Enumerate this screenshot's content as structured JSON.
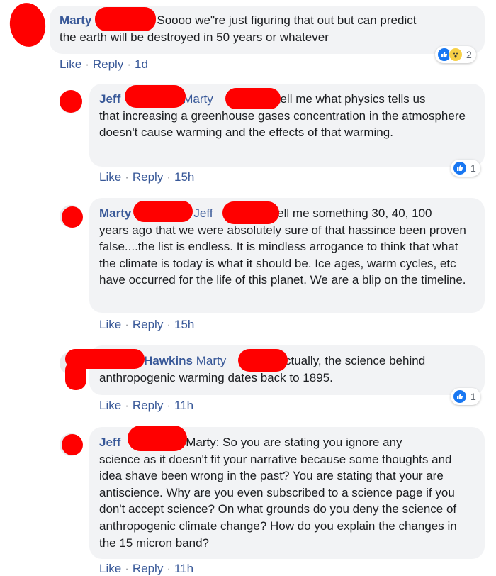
{
  "reaction_colors": {
    "like": "#1877f2",
    "wow": "#f7d046"
  },
  "comments": [
    {
      "author": "Marty",
      "text_line1": "Soooo we\"re just figuring that out but can predict",
      "text_rest": "the earth will be destroyed in 50 years or whatever",
      "like": "Like",
      "reply": "Reply",
      "time": "1d",
      "reactions": [
        "like-reaction-icon",
        "wow-reaction-icon"
      ],
      "reaction_count": "2"
    },
    {
      "author": "Jeff",
      "mention": "Marty",
      "text_line1": "tell me what physics tells us",
      "text_rest": "that increasing a greenhouse gases concentration in the atmosphere doesn't cause warming and the effects of that warming.",
      "like": "Like",
      "reply": "Reply",
      "time": "15h",
      "reactions": [
        "like-reaction-icon"
      ],
      "reaction_count": "1"
    },
    {
      "author": "Marty",
      "mention": "Jeff",
      "text_line1": "tell me something 30, 40, 100",
      "text_rest": "years ago that we were absolutely sure of that hassince been proven false....the list is endless. It is mindless arrogance to think that what the climate is today is what it should be. Ice ages, warm cycles, etc have occurred for the life of this planet. We are a blip on the timeline.",
      "like": "Like",
      "reply": "Reply",
      "time": "15h"
    },
    {
      "author": "Hawkins",
      "mention": "Marty",
      "text_line1": "r Actually, the science behind",
      "text_rest": "anthropogenic warming dates back to 1895.",
      "like": "Like",
      "reply": "Reply",
      "time": "11h",
      "reactions": [
        "like-reaction-icon"
      ],
      "reaction_count": "1"
    },
    {
      "author": "Jeff",
      "mention": "Marty: So you are stating you ignore any",
      "text_rest": "science as it doesn't fit your narrative because some thoughts and idea shave been wrong in the past? You are stating that your are antiscience. Why are you even subscribed to a science page if you don't accept science? On what grounds do you deny the science of anthropogenic climate change? How do you explain the changes in the 15 micron band?",
      "like": "Like",
      "reply": "Reply",
      "time": "11h"
    }
  ]
}
